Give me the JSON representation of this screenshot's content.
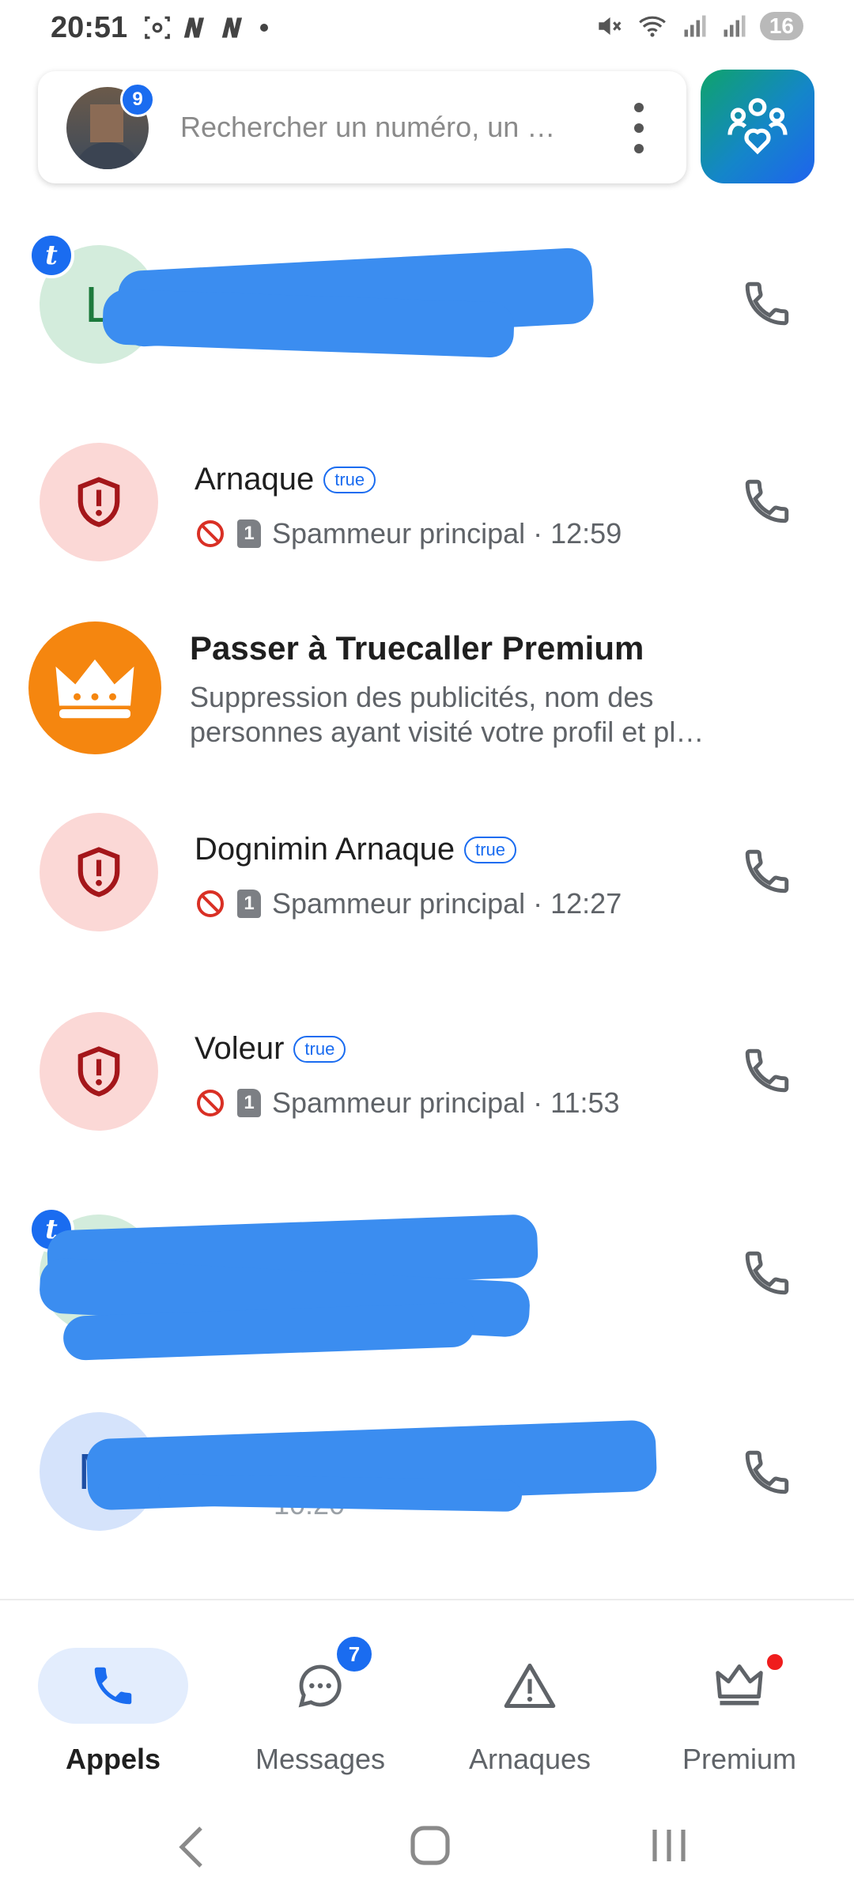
{
  "status_bar": {
    "time": "20:51",
    "battery": "16",
    "icons": [
      "screenshot-icon",
      "n-app-icon",
      "n-app-icon",
      "dot-icon",
      "mute-icon",
      "wifi-icon",
      "signal-icon",
      "signal-icon"
    ]
  },
  "search": {
    "placeholder": "Rechercher un numéro, un …",
    "avatar_badge": "9"
  },
  "calls": [
    {
      "name": "",
      "redacted": true,
      "avatar_letter": "L",
      "truecaller_badge": true
    },
    {
      "name": "Arnaque",
      "badge": "true",
      "status": "Spammeur principal · 12:59",
      "sim": "1"
    },
    {
      "name": "Dognimin Arnaque",
      "badge": "true",
      "status": "Spammeur principal · 12:27",
      "sim": "1"
    },
    {
      "name": "Voleur",
      "badge": "true",
      "status": "Spammeur principal · 11:53",
      "sim": "1"
    },
    {
      "name": "",
      "redacted": true,
      "avatar_letter": "",
      "truecaller_badge": true
    },
    {
      "name": "",
      "redacted": true,
      "avatar_letter": "M",
      "partial_time": "10:20"
    }
  ],
  "promo": {
    "title": "Passer à Truecaller Premium",
    "description": "Suppression des publicités, nom des personnes ayant visité votre profil et pl…"
  },
  "bottom_nav": {
    "items": [
      {
        "label": "Appels",
        "icon": "phone-icon",
        "active": true
      },
      {
        "label": "Messages",
        "icon": "chat-icon",
        "badge": "7"
      },
      {
        "label": "Arnaques",
        "icon": "warning-icon"
      },
      {
        "label": "Premium",
        "icon": "crown-icon",
        "dot": true
      }
    ]
  },
  "colors": {
    "accent": "#1a6cf0",
    "spam_bg": "#fbd8d6",
    "spam_icon": "#a4161a",
    "premium_orange": "#f5860f",
    "redaction": "#3b8df0"
  }
}
